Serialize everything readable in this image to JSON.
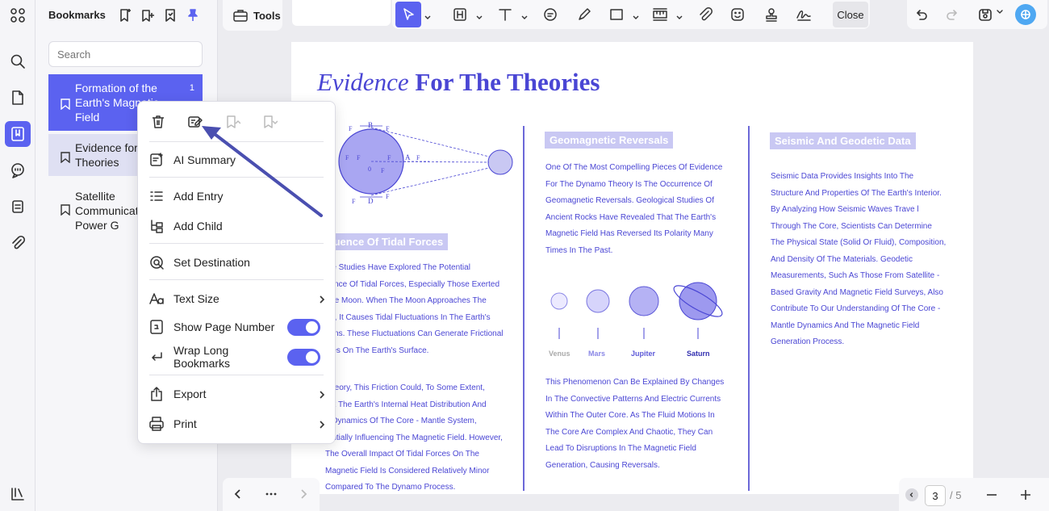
{
  "left_rail": {
    "icons": [
      "apps-icon",
      "search-icon",
      "page-icon",
      "bookmark-icon",
      "comment-icon",
      "layers-icon",
      "attachment-icon",
      "library-icon"
    ]
  },
  "panel": {
    "title": "Bookmarks",
    "search_placeholder": "Search",
    "bookmarks": [
      {
        "label": "Formation of the Earth's Magnetic Field",
        "page": "1"
      },
      {
        "label": "Evidence for Theories"
      },
      {
        "label": "Satellite Communication and Power G"
      }
    ]
  },
  "context_menu": {
    "items": {
      "ai_summary": "AI Summary",
      "add_entry": "Add Entry",
      "add_child": "Add Child",
      "set_destination": "Set Destination",
      "text_size": "Text Size",
      "show_page_number": "Show Page Number",
      "wrap_long_bookmarks": "Wrap Long Bookmarks",
      "export": "Export",
      "print": "Print"
    },
    "toggles": {
      "show_page_number": true,
      "wrap_long_bookmarks": true
    }
  },
  "toolbar": {
    "tools_label": "Tools",
    "close_label": "Close"
  },
  "document": {
    "title_italic": "Evidence",
    "title_bold": "For The Theories",
    "tidal_heading": "luence Of Tidal Forces",
    "tidal_p1": [
      "me Studies Have Explored The Potential",
      "uence Of Tidal Forces, Especially Those Exerted",
      "The Moon. When The Moon Approaches The",
      "rth, It Causes Tidal Fluctuations In The Earth's",
      "eans. These Fluctuations Can Generate Frictional",
      "rces On The Earth's Surface."
    ],
    "tidal_p2": [
      "Theory, This Friction Could, To Some Extent,",
      "ect The Earth's Internal Heat Distribution And",
      "e Dynamics Of The Core - Mantle System,",
      "tentially Influencing The Magnetic Field. However,",
      "The Overall Impact Of Tidal Forces On The",
      "Magnetic Field Is Considered Relatively Minor",
      "Compared To The Dynamo Process."
    ],
    "geo_heading": "Geomagnetic Reversals",
    "geo_p1": [
      "One Of The Most Compelling Pieces Of Evidence",
      "For The Dynamo Theory Is The Occurrence Of",
      "Geomagnetic Reversals. Geological Studies Of",
      "Ancient Rocks Have Revealed That The Earth's",
      "Magnetic Field Has Reversed Its Polarity Many",
      "Times In The Past."
    ],
    "geo_p2": [
      "This Phenomenon Can Be Explained By Changes",
      "In The Convective Patterns And Electric Currents",
      "Within The Outer Core. As The Fluid Motions In",
      "The Core Are Complex And Chaotic, They Can",
      "Lead To Disruptions In The Magnetic Field",
      "Generation, Causing Reversals."
    ],
    "planets": [
      "Venus",
      "Mars",
      "Jupiter",
      "Saturn"
    ],
    "seis_heading": "Seismic And Geodetic Data",
    "seis_p": [
      "Seismic Data Provides Insights Into The",
      "Structure And Properties Of The Earth's Interior.",
      "By Analyzing How Seismic Waves Trave l",
      "Through The Core, Scientists Can Determine",
      "The Physical State (Solid Or Fluid), Composition,",
      "And Density Of The Materials. Geodetic",
      "Measurements, Such As Those From Satellite -",
      "Based Gravity And Magnetic Field Surveys, Also",
      "Contribute To Our Understanding Of The Core -",
      "Mantle Dynamics And The Magnetic Field",
      "Generation Process."
    ],
    "diagram_labels": [
      "B",
      "F",
      "F",
      "F",
      "F",
      "F",
      "A",
      "F",
      "0",
      "F",
      "F",
      "D",
      "F"
    ]
  },
  "pager": {
    "current": "3",
    "total": "/ 5"
  },
  "colors": {
    "accent": "#5b62f0",
    "doc_text": "#4a46d4",
    "heading_bg": "#c9c8f3"
  }
}
